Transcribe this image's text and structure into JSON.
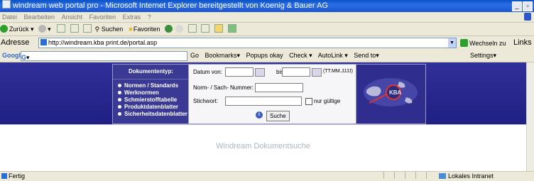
{
  "window": {
    "title": "windream web portal pro - Microsoft Internet Explorer bereitgestellt von Koenig & Bauer AG",
    "buttons": [
      "_",
      "▫"
    ]
  },
  "menu": {
    "items": [
      "Datei",
      "Bearbeiten",
      "Ansicht",
      "Favoriten",
      "Extras",
      "?"
    ]
  },
  "toolbar": {
    "back": "Zurück",
    "search": "Suchen",
    "favorites": "Favoriten"
  },
  "address": {
    "label": "Adresse",
    "url": "http://windream.kba print.de/portal.asp",
    "go": "Wechseln zu",
    "links": "Links"
  },
  "googlebar": {
    "logo": "Google",
    "input_prefix": "G",
    "items": [
      "Go",
      "Bookmarks▾",
      "Popups okay",
      "Check ▾",
      "AutoLink ▾",
      "Send to▾"
    ],
    "settings": "Settings▾"
  },
  "portal": {
    "doctype_title": "Dokumententyp:",
    "doctypes": [
      "Normen / Standards",
      "Werknormen",
      "Schmierstofftabelle",
      "Produktdatenblatter",
      "Sicherheitsdatenblatter"
    ],
    "date_from_label": "Datum von:",
    "date_to_label": "bis:",
    "date_format": "(TT.MM.JJJJ)",
    "norm_label": "Norm- / Sach- Nummer:",
    "keyword_label": "Stichwort:",
    "only_valid_label": "nur gültige",
    "search_button": "Suche",
    "logo_text": "KBA",
    "heading": "Windream Dokumentsuche"
  },
  "status": {
    "text": "Fertig",
    "zone": "Lokales Intranet"
  }
}
